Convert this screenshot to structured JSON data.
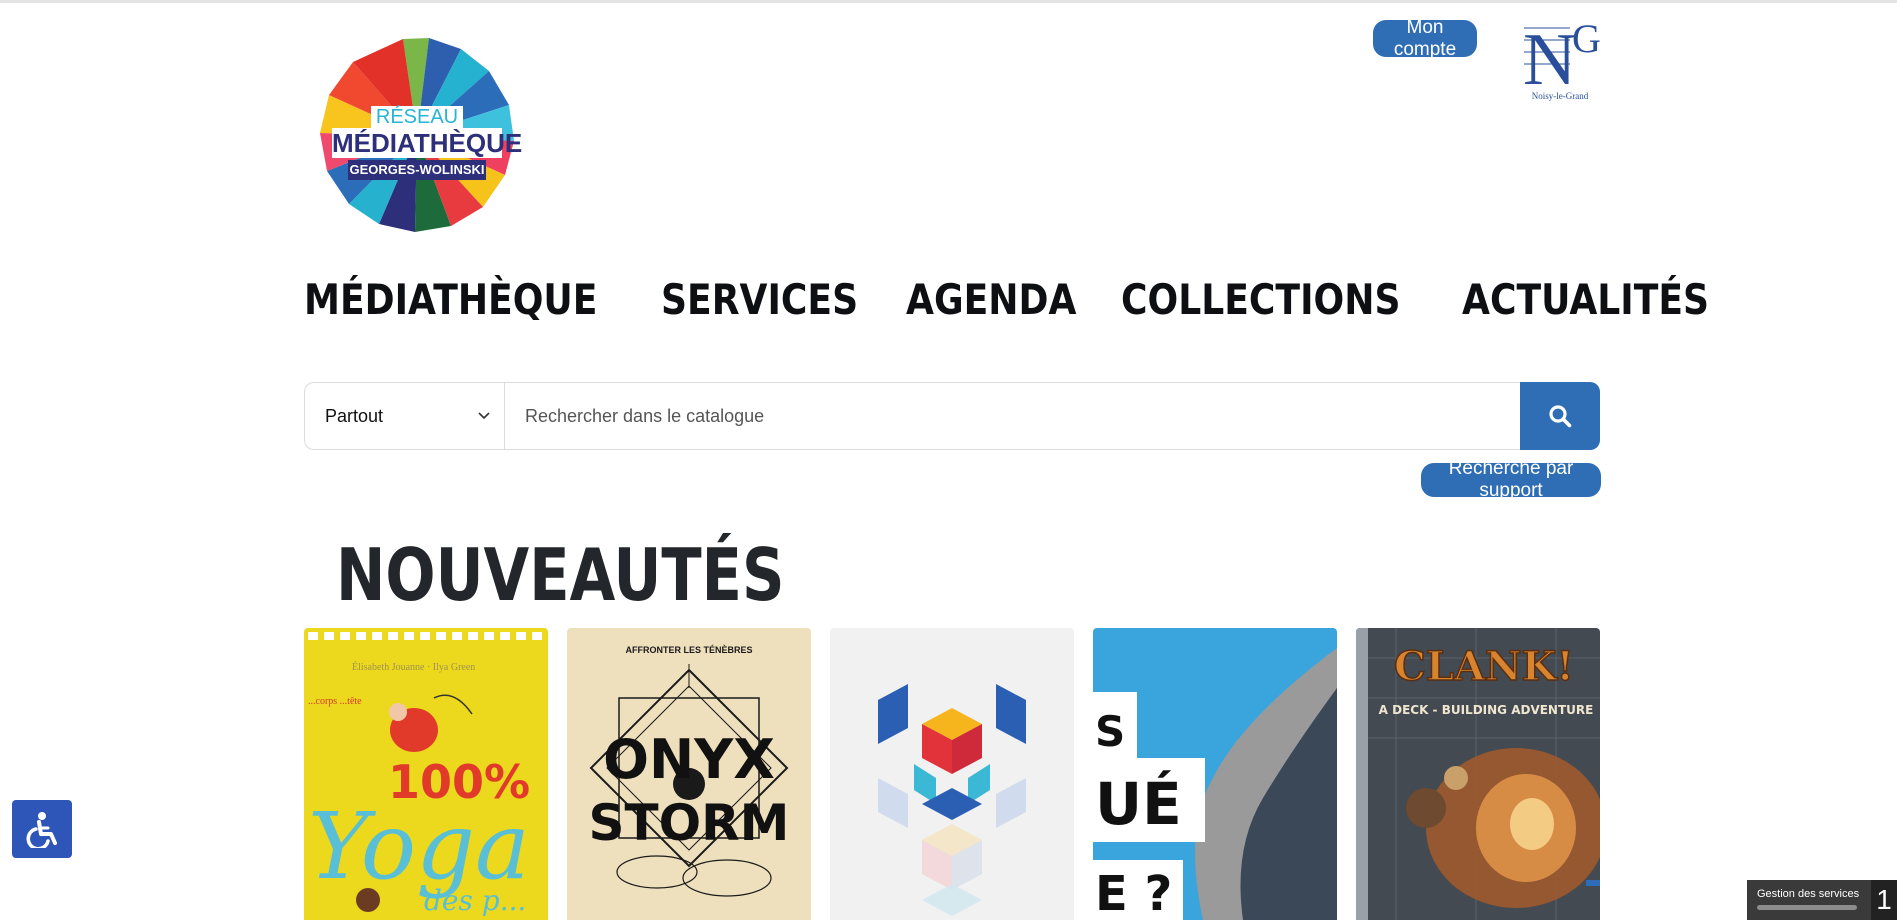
{
  "logo": {
    "reseau": "RÉSEAU",
    "mediatheque": "MÉDIATHÈQUE",
    "subtitle": "GEORGES-WOLINSKI"
  },
  "header": {
    "account_label": "Mon compte",
    "city_logo_caption": "Noisy-le-Grand",
    "city_logo_letters": "NG"
  },
  "nav": {
    "items": [
      "MÉDIATHÈQUE",
      "SERVICES",
      "AGENDA",
      "COLLECTIONS",
      "ACTUALITÉS"
    ]
  },
  "search": {
    "scope_selected": "Partout",
    "placeholder": "Rechercher dans le catalogue",
    "submit_icon": "search-icon",
    "by_support_label": "Recherche par support"
  },
  "news": {
    "title": "NOUVEAUTÉS",
    "items": [
      {
        "cover_texts": [
          "Élisabeth Jouanne · Ilya Green",
          "...corps ...tête",
          "100%",
          "Yoga",
          "des p..."
        ]
      },
      {
        "cover_texts": [
          "AFFRONTER LES TÉNÈBRES",
          "ONYX",
          "STORM"
        ]
      },
      {
        "cover_texts": []
      },
      {
        "cover_texts": [
          "S",
          "UÉ",
          "E ?"
        ]
      },
      {
        "cover_texts": [
          "CLANK!",
          "A DECK - BUILDING ADVENTURE"
        ]
      }
    ]
  },
  "widgets": {
    "accessibility_icon": "wheelchair-icon",
    "cookie_label": "Gestion des services",
    "cookie_count": "1"
  },
  "colors": {
    "brand_blue": "#2f6db5",
    "access_blue": "#2e55b8",
    "logo_navy": "#2d2f7a",
    "logo_cyan": "#27b5d3"
  }
}
